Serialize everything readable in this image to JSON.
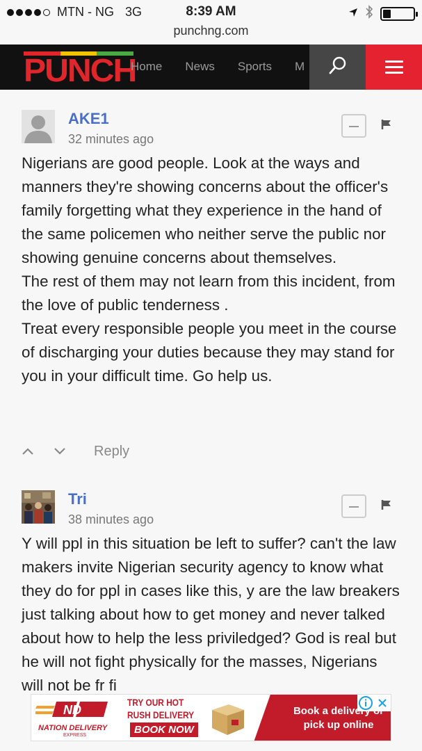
{
  "status_bar": {
    "carrier": "MTN - NG",
    "network": "3G",
    "time": "8:39 AM",
    "battery_level": 0.25,
    "signal_bars_filled": 4,
    "signal_bars_total": 5
  },
  "browser": {
    "url": "punchng.com"
  },
  "navbar": {
    "logo_text": "PUNCH",
    "logo_colors": [
      "#e0262b",
      "#f2c400",
      "#49a942"
    ],
    "links": [
      "Home",
      "News",
      "Sports",
      "M"
    ],
    "search_icon": "search-icon",
    "menu_icon": "hamburger-menu-icon",
    "accent_color": "#e52330"
  },
  "comments": [
    {
      "author": "AKE1",
      "time": "32 minutes ago",
      "avatar": "default-user-avatar",
      "paragraphs": [
        "Nigerians are good people. Look at the ways and manners they're showing concerns about the officer's family forgetting what they experience in the hand of the same policemen who neither serve the public nor showing genuine concerns about themselves.",
        "The rest of them may not learn from this incident, from the love of public tenderness .",
        "Treat every responsible people you meet in the course of discharging your duties because they may stand for you in your difficult time. Go help us."
      ],
      "reply_label": "Reply"
    },
    {
      "author": "Tri",
      "time": "38 minutes ago",
      "avatar": "photo-avatar",
      "paragraphs": [
        "Y will ppl in this situation be left to suffer? can't the law makers invite Nigerian security agency to know what they do for ppl in cases like this, y are the law breakers just talking about how to get money and never talked about how to help the less priviledged? God is real but he will not fight physically for the masses, Nigerians will not be fr fi"
      ]
    }
  ],
  "ad": {
    "brand": "NATION DELIVERY",
    "brand_sub": "EXPRESS",
    "headline_1": "TRY OUR HOT",
    "headline_2": "RUSH DELIVERY",
    "cta": "BOOK NOW",
    "right_text": "Book a delivery or pick up online",
    "brand_color": "#c21b2a"
  }
}
